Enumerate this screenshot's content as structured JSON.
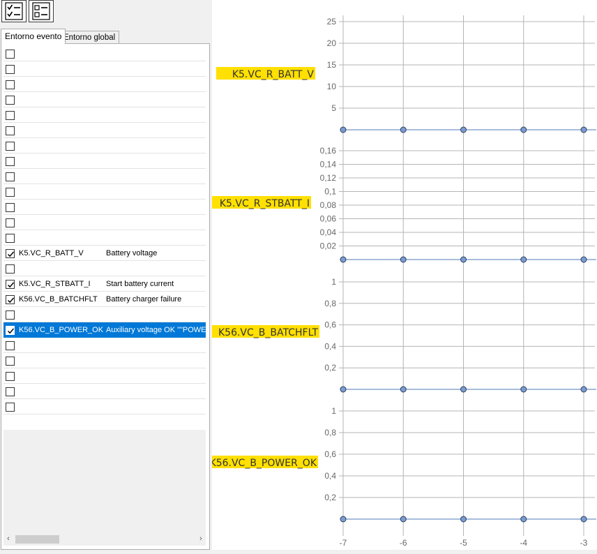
{
  "toolbar": {
    "buttons": [
      {
        "icon": "checklist-icon"
      },
      {
        "icon": "list-icon"
      }
    ]
  },
  "tabs": [
    {
      "label": "Entorno evento",
      "active": true
    },
    {
      "label": "Entorno global",
      "active": false
    }
  ],
  "signals": [
    {
      "checked": false,
      "name": "",
      "description": ""
    },
    {
      "checked": false,
      "name": "",
      "description": ""
    },
    {
      "checked": false,
      "name": "",
      "description": ""
    },
    {
      "checked": false,
      "name": "",
      "description": ""
    },
    {
      "checked": false,
      "name": "",
      "description": ""
    },
    {
      "checked": false,
      "name": "",
      "description": ""
    },
    {
      "checked": false,
      "name": "",
      "description": ""
    },
    {
      "checked": false,
      "name": "",
      "description": ""
    },
    {
      "checked": false,
      "name": "",
      "description": ""
    },
    {
      "checked": false,
      "name": "",
      "description": ""
    },
    {
      "checked": false,
      "name": "",
      "description": ""
    },
    {
      "checked": false,
      "name": "",
      "description": ""
    },
    {
      "checked": false,
      "name": "",
      "description": ""
    },
    {
      "checked": true,
      "name": "K5.VC_R_BATT_V",
      "description": "Battery voltage"
    },
    {
      "checked": false,
      "name": "",
      "description": ""
    },
    {
      "checked": true,
      "name": "K5.VC_R_STBATT_I",
      "description": "Start battery current"
    },
    {
      "checked": true,
      "name": "K56.VC_B_BATCHFLT",
      "description": "Battery charger failure"
    },
    {
      "checked": false,
      "name": "",
      "description": ""
    },
    {
      "checked": true,
      "name": "K56.VC_B_POWER_OK",
      "description": "Auxiliary voltage OK \"\"POWER",
      "selected": true
    },
    {
      "checked": false,
      "name": "",
      "description": ""
    },
    {
      "checked": false,
      "name": "",
      "description": ""
    },
    {
      "checked": false,
      "name": "",
      "description": ""
    },
    {
      "checked": false,
      "name": "",
      "description": ""
    },
    {
      "checked": false,
      "name": "",
      "description": ""
    }
  ],
  "colors": {
    "highlight": "#ffe000",
    "selection": "#0078d7",
    "series_line": "#4f79b8",
    "marker_fill": "#7b9bd0",
    "grid": "#b4b4b4"
  },
  "chart_data": [
    {
      "type": "line",
      "label": "K5.VC_R_BATT_V",
      "x": [
        -7,
        -6,
        -5,
        -4,
        -3
      ],
      "y": [
        0,
        0,
        0,
        0,
        0
      ],
      "yticks": [
        "5",
        "10",
        "15",
        "20",
        "25"
      ],
      "ylim": [
        0,
        25
      ]
    },
    {
      "type": "line",
      "label": "K5.VC_R_STBATT_I",
      "x": [
        -7,
        -6,
        -5,
        -4,
        -3
      ],
      "y": [
        0,
        0,
        0,
        0,
        0
      ],
      "yticks": [
        "0,02",
        "0,04",
        "0,06",
        "0,08",
        "0,1",
        "0,12",
        "0,14",
        "0,16"
      ],
      "ylim": [
        0,
        0.16
      ]
    },
    {
      "type": "line",
      "label": "K56.VC_B_BATCHFLT",
      "x": [
        -7,
        -6,
        -5,
        -4,
        -3
      ],
      "y": [
        0,
        0,
        0,
        0,
        0
      ],
      "yticks": [
        "0,2",
        "0,4",
        "0,6",
        "0,8",
        "1"
      ],
      "ylim": [
        0,
        1
      ]
    },
    {
      "type": "line",
      "label": "K56.VC_B_POWER_OK",
      "x": [
        -7,
        -6,
        -5,
        -4,
        -3
      ],
      "y": [
        0,
        0,
        0,
        0,
        0
      ],
      "yticks": [
        "0,2",
        "0,4",
        "0,6",
        "0,8",
        "1"
      ],
      "ylim": [
        0,
        1
      ]
    }
  ],
  "x_axis": {
    "ticks": [
      "-7",
      "-6",
      "-5",
      "-4",
      "-3"
    ],
    "values": [
      -7,
      -6,
      -5,
      -4,
      -3
    ],
    "xlim": [
      -7,
      -3
    ]
  }
}
